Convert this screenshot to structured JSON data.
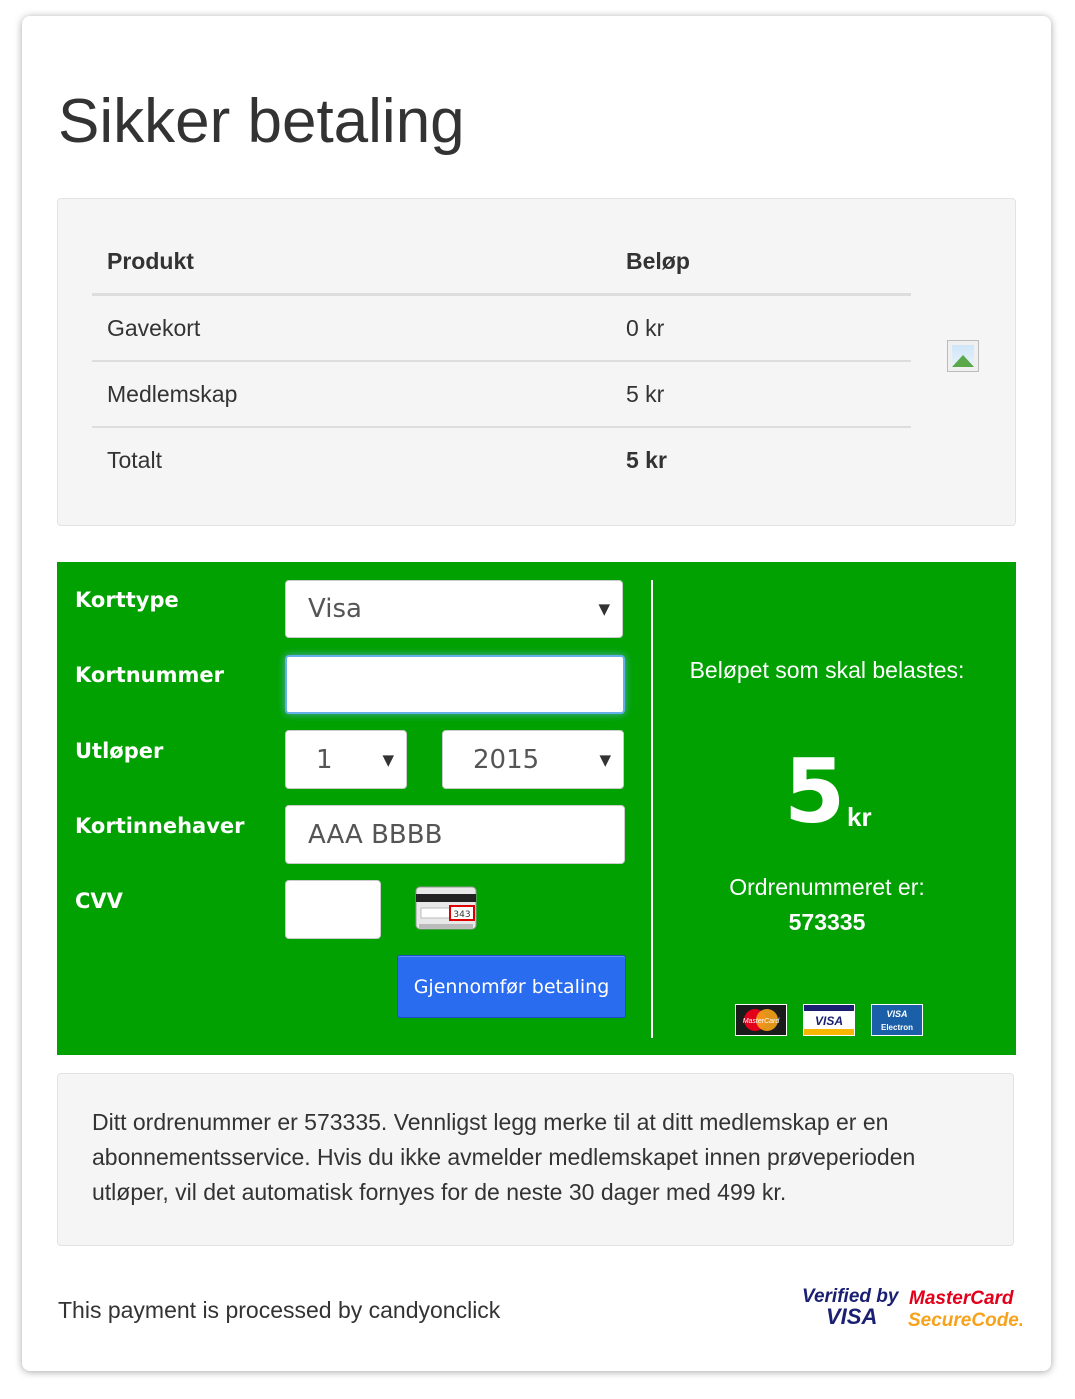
{
  "page": {
    "title": "Sikker betaling"
  },
  "summary": {
    "headers": {
      "product": "Produkt",
      "amount": "Beløp"
    },
    "rows": [
      {
        "product": "Gavekort",
        "amount": "0 kr"
      },
      {
        "product": "Medlemskap",
        "amount": "5 kr"
      },
      {
        "product": "Totalt",
        "amount": "5 kr"
      }
    ]
  },
  "payment_form": {
    "card_type": {
      "label": "Korttype",
      "value": "Visa"
    },
    "card_number": {
      "label": "Kortnummer",
      "value": ""
    },
    "expiry": {
      "label": "Utløper",
      "month": "1",
      "year": "2015"
    },
    "card_holder": {
      "label": "Kortinnehaver",
      "value": "AAA BBBB"
    },
    "cvv": {
      "label": "CVV",
      "value": "",
      "hint_number": "343"
    },
    "submit_label": "Gjennomfør betaling"
  },
  "charge": {
    "label": "Beløpet som skal belastes:",
    "amount": "5",
    "currency": "kr",
    "order_label": "Ordrenummeret er:",
    "order_number": "573335"
  },
  "card_logos": {
    "mastercard": "MasterCard",
    "visa": "VISA",
    "visa_electron_top": "VISA",
    "visa_electron_bottom": "Electron"
  },
  "notice": {
    "text": "Ditt ordrenummer er 573335. Vennligst legg merke til at ditt medlemskap er en abonnementsservice. Hvis du ikke avmelder medlemskapet innen prøveperioden utløper, vil det automatisk fornyes for de neste 30 dager med 499 kr."
  },
  "footer": {
    "processed_by": "This payment is processed by candyonclick",
    "verified_by": "Verified by",
    "visa": "VISA",
    "mastercard": "MasterCard",
    "securecode": "SecureCode."
  },
  "colors": {
    "panel_green": "#00a100",
    "button_blue": "#2a6cf0",
    "mastercard_red": "#e2001a",
    "visa_blue": "#1a1f71"
  }
}
